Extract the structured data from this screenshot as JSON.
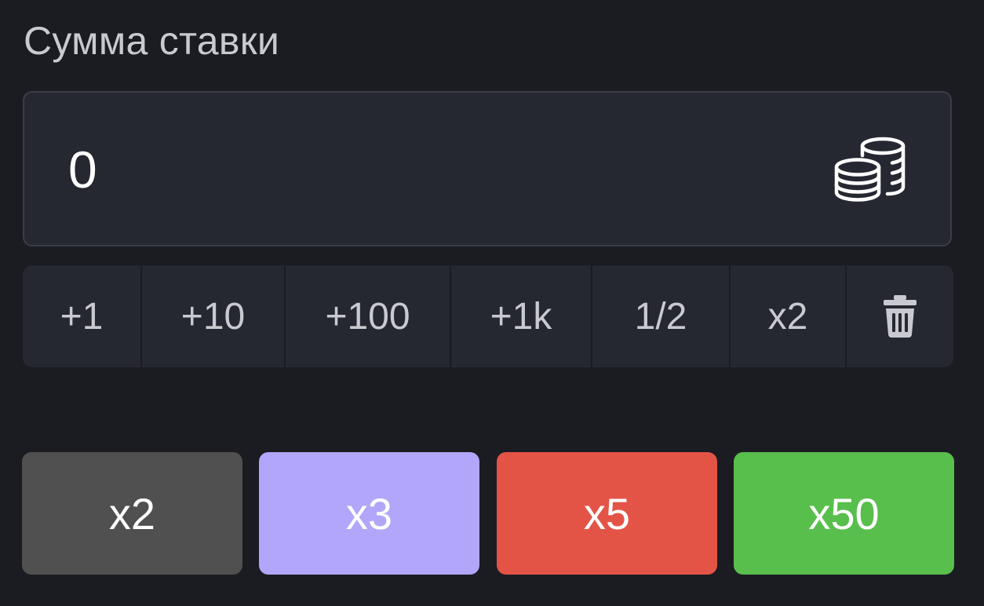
{
  "bet": {
    "title": "Сумма ставки",
    "amount_value": "0",
    "currency_icon": "coins-icon"
  },
  "quick_buttons": [
    {
      "label": "+1"
    },
    {
      "label": "+10"
    },
    {
      "label": "+100"
    },
    {
      "label": "+1k"
    },
    {
      "label": "1/2"
    },
    {
      "label": "x2"
    },
    {
      "icon": "trash-icon"
    }
  ],
  "multipliers": [
    {
      "label": "x2",
      "color": "#505050"
    },
    {
      "label": "x3",
      "color": "#b2a6fa"
    },
    {
      "label": "x5",
      "color": "#e35447"
    },
    {
      "label": "x50",
      "color": "#58bf4c"
    }
  ]
}
